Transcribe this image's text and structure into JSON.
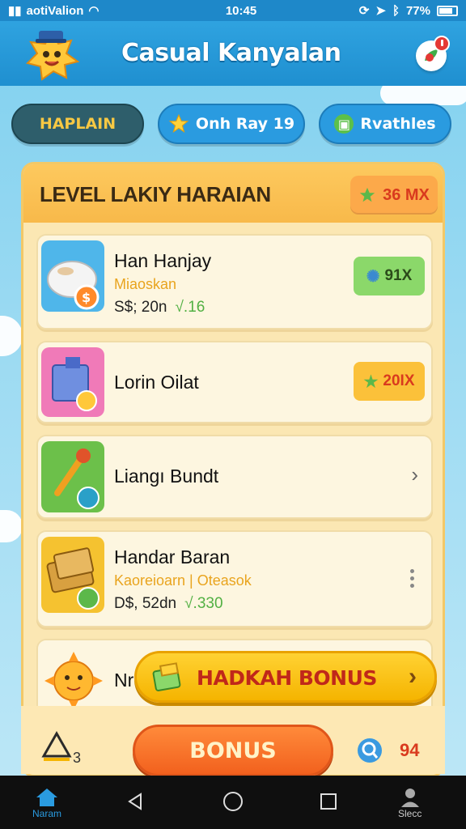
{
  "status_bar": {
    "carrier": "aotiValion",
    "time": "10:45",
    "battery": "77%"
  },
  "header": {
    "title": "Casual Kanyalan"
  },
  "tabs": [
    {
      "label": "HAPLAIN",
      "active": true
    },
    {
      "label": "Onh Ray 19",
      "icon": "star-icon"
    },
    {
      "label": "Rvathles",
      "icon": "gift-icon"
    }
  ],
  "panel": {
    "title": "LEVEL LAKIY HARAIAN",
    "badge": "36 MX"
  },
  "items": [
    {
      "name": "Han Hanjay",
      "sub": "Miaoskan",
      "price": "S$; 20n",
      "trend": "√.16",
      "badge": "91X",
      "badge_color": "#8bd86a"
    },
    {
      "name": "Lorin Oilat",
      "badge": "20IX",
      "badge_color": "#fbc13a"
    },
    {
      "name": "Liangı Bundt"
    },
    {
      "name": "Handar Baran",
      "sub": "Kaoreioarn | Oteasok",
      "price": "D$, 52dn",
      "trend": "√.330"
    },
    {
      "name": "Nr"
    }
  ],
  "bonus_banner": {
    "label": "HADKAH BONUS"
  },
  "bottom": {
    "bonus_label": "BONUS",
    "left_count": "3",
    "right_count": "94"
  },
  "navbar": {
    "home_label": "Naram",
    "profile_label": "Slecc"
  },
  "colors": {
    "accent": "#1f8fd0",
    "panel": "#fbe7b3",
    "bonus_orange": "#f2611e",
    "bonus_yellow": "#ffd233"
  }
}
